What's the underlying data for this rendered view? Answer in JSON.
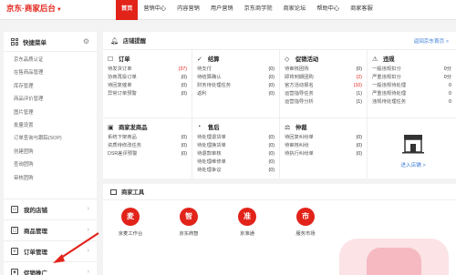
{
  "app": {
    "logo": "京东·商家后台",
    "nav": [
      "首页",
      "营销中心",
      "内容营销",
      "用户营销",
      "京东商学院",
      "商家论坛",
      "帮助中心",
      "商家客服"
    ]
  },
  "sidebar": {
    "title": "快捷菜单",
    "links": [
      "京东品质认证",
      "在售商品管理",
      "库存管理",
      "商品评价管理",
      "图片管理",
      "批量设置",
      "订单查询与跟踪(SOP)",
      "创建团购",
      "查询团购",
      "审核团购"
    ],
    "sections": [
      "我的店铺",
      "商品管理",
      "订单管理",
      "促销推广"
    ]
  },
  "reminder": {
    "title": "店铺提醒",
    "link": "返回京东首页 >",
    "blocks": [
      {
        "icon": "☐",
        "title": "订单",
        "rows": [
          [
            "待发货订单",
            "(37)",
            "red"
          ],
          [
            "协商再投订单",
            "(0)",
            ""
          ],
          [
            "待回复催单",
            "(0)",
            ""
          ],
          [
            "异常订单预警",
            "(0)",
            ""
          ]
        ]
      },
      {
        "icon": "✓",
        "title": "结算",
        "rows": [
          [
            "待支付",
            "(0)",
            ""
          ],
          [
            "待结算确认",
            "(0)",
            ""
          ],
          [
            "财务待处理任务",
            "(0)",
            ""
          ],
          [
            "返利",
            "(0)",
            ""
          ]
        ]
      },
      {
        "icon": "◇",
        "title": "促销活动",
        "rows": [
          [
            "待审核团购",
            "(0)",
            ""
          ],
          [
            "即将到期团购",
            "(2)",
            "red"
          ],
          [
            "官方活动报名",
            "(10)",
            "red"
          ],
          [
            "运营指导任务",
            "(1)",
            ""
          ],
          [
            "运营指导分析",
            "(1)",
            ""
          ]
        ]
      },
      {
        "icon": "⚠",
        "title": "违规",
        "rows": [
          [
            "一般违规扣分",
            "0分",
            ""
          ],
          [
            "严重违规扣分",
            "0分",
            ""
          ],
          [
            "一般违规待处理",
            "0",
            ""
          ],
          [
            "严重违规待处理",
            "0",
            ""
          ],
          [
            "违规待处理任务",
            "0",
            ""
          ]
        ]
      },
      {
        "icon": "▣",
        "title": "商家发商品",
        "rows": [
          [
            "系统下架商品",
            "(0)",
            ""
          ],
          [
            "资质待修改任务",
            "(0)",
            ""
          ],
          [
            "DSR差评预警",
            "(0)",
            ""
          ]
        ]
      },
      {
        "icon": "◔",
        "title": "售后",
        "rows": [
          [
            "待处理退货单",
            "(0)",
            ""
          ],
          [
            "待处理换货单",
            "(0)",
            ""
          ],
          [
            "待退款审核",
            "(0)",
            ""
          ],
          [
            "待处理维修单",
            "(0)",
            ""
          ],
          [
            "待处理争议",
            "(0)",
            ""
          ]
        ]
      },
      {
        "icon": "⚖",
        "title": "仲裁",
        "rows": [
          [
            "待回复纠纷单",
            "(0)",
            ""
          ],
          [
            "待审核纠纷",
            "(0)",
            ""
          ],
          [
            "待执行纠纷单",
            "(0)",
            ""
          ]
        ]
      }
    ],
    "store_link": "进入店铺 >"
  },
  "tools": {
    "title": "商家工具",
    "items": [
      {
        "label": "京麦工作台",
        "glyph": "麦"
      },
      {
        "label": "京东商智",
        "glyph": "智"
      },
      {
        "label": "京准通",
        "glyph": "准"
      },
      {
        "label": "服务市场",
        "glyph": "市"
      }
    ]
  },
  "colors": {
    "brand": "#e2231a",
    "link": "#3a7bd5"
  }
}
